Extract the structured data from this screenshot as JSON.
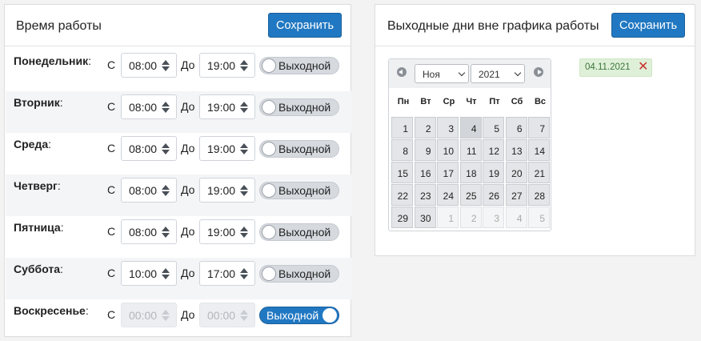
{
  "work_hours": {
    "title": "Время работы",
    "save_label": "Сохранить",
    "from_label": "С",
    "to_label": "До",
    "colon": ":",
    "days": [
      {
        "name": "Понедельник",
        "from": "08:00",
        "to": "19:00",
        "dayoff_label": "Выходной",
        "is_day_off": false,
        "disabled": false
      },
      {
        "name": "Вторник",
        "from": "08:00",
        "to": "19:00",
        "dayoff_label": "Выходной",
        "is_day_off": false,
        "disabled": false
      },
      {
        "name": "Среда",
        "from": "08:00",
        "to": "19:00",
        "dayoff_label": "Выходной",
        "is_day_off": false,
        "disabled": false
      },
      {
        "name": "Четверг",
        "from": "08:00",
        "to": "19:00",
        "dayoff_label": "Выходной",
        "is_day_off": false,
        "disabled": false
      },
      {
        "name": "Пятница",
        "from": "08:00",
        "to": "19:00",
        "dayoff_label": "Выходной",
        "is_day_off": false,
        "disabled": false
      },
      {
        "name": "Суббота",
        "from": "10:00",
        "to": "17:00",
        "dayoff_label": "Выходной",
        "is_day_off": false,
        "disabled": false
      },
      {
        "name": "Воскресенье",
        "from": "00:00",
        "to": "00:00",
        "dayoff_label": "Выходной",
        "is_day_off": true,
        "disabled": true
      }
    ]
  },
  "holidays": {
    "title": "Выходные дни вне графика работы",
    "save_label": "Сохранить",
    "calendar": {
      "month": "Ноя",
      "year": "2021",
      "weekdays": [
        "Пн",
        "Вт",
        "Ср",
        "Чт",
        "Пт",
        "Сб",
        "Вс"
      ],
      "weeks": [
        [
          "1",
          "2",
          "3",
          "4",
          "5",
          "6",
          "7"
        ],
        [
          "8",
          "9",
          "10",
          "11",
          "12",
          "13",
          "14"
        ],
        [
          "15",
          "16",
          "17",
          "18",
          "19",
          "20",
          "21"
        ],
        [
          "22",
          "23",
          "24",
          "25",
          "26",
          "27",
          "28"
        ],
        [
          "29",
          "30",
          "1",
          "2",
          "3",
          "4",
          "5"
        ]
      ],
      "other_month_cells": [
        [
          4,
          2
        ],
        [
          4,
          3
        ],
        [
          4,
          4
        ],
        [
          4,
          5
        ],
        [
          4,
          6
        ]
      ],
      "highlighted_cell": [
        0,
        3
      ]
    },
    "selected_dates": [
      "04.11.2021"
    ],
    "remove_icon": "close-icon"
  },
  "colors": {
    "primary": "#2178c2",
    "tag_bg": "#dff0d8",
    "tag_text": "#3c763d",
    "remove": "#c9302c"
  }
}
